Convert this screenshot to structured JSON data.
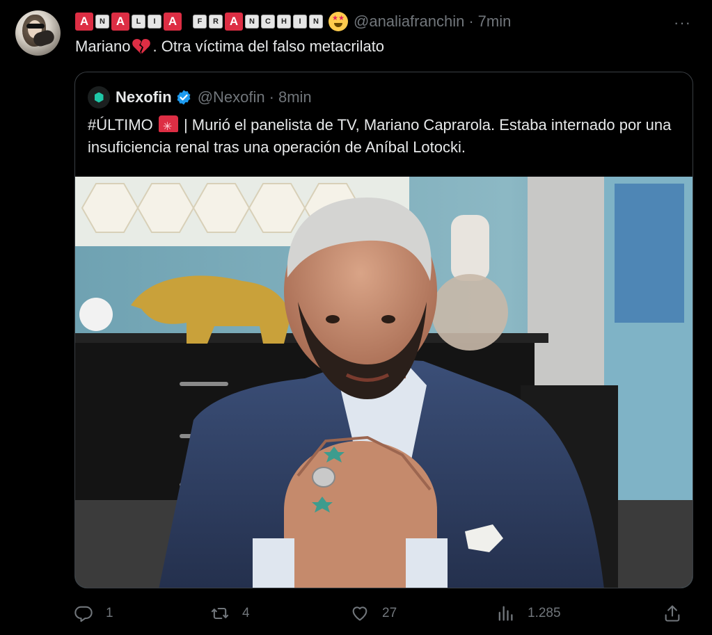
{
  "tweet": {
    "display_name_tiles": [
      "A",
      "N",
      "A",
      "L",
      "I",
      "A",
      "F",
      "R",
      "A",
      "N",
      "C",
      "H",
      "I",
      "N"
    ],
    "handle": "@analiafranchin",
    "separator": "·",
    "time": "7min",
    "more_label": "···",
    "text_before_emoji": "Mariano",
    "text_after_emoji": ". Otra víctima del falso metacrilato"
  },
  "quoted": {
    "name": "Nexofin",
    "handle": "@Nexofin",
    "separator": "·",
    "time": "8min",
    "text_prefix": "#ÚLTIMO",
    "text_body": "| Murió el panelista de TV, Mariano Caprarola. Estaba internado por una insuficiencia renal tras una operación de Aníbal Lotocki."
  },
  "actions": {
    "reply_count": "1",
    "retweet_count": "4",
    "like_count": "27",
    "views_count": "1.285"
  },
  "colors": {
    "background": "#000000",
    "text": "#e7e9ea",
    "muted": "#71767b",
    "verified": "#1d9bf0",
    "tile_red": "#dd2e44"
  }
}
